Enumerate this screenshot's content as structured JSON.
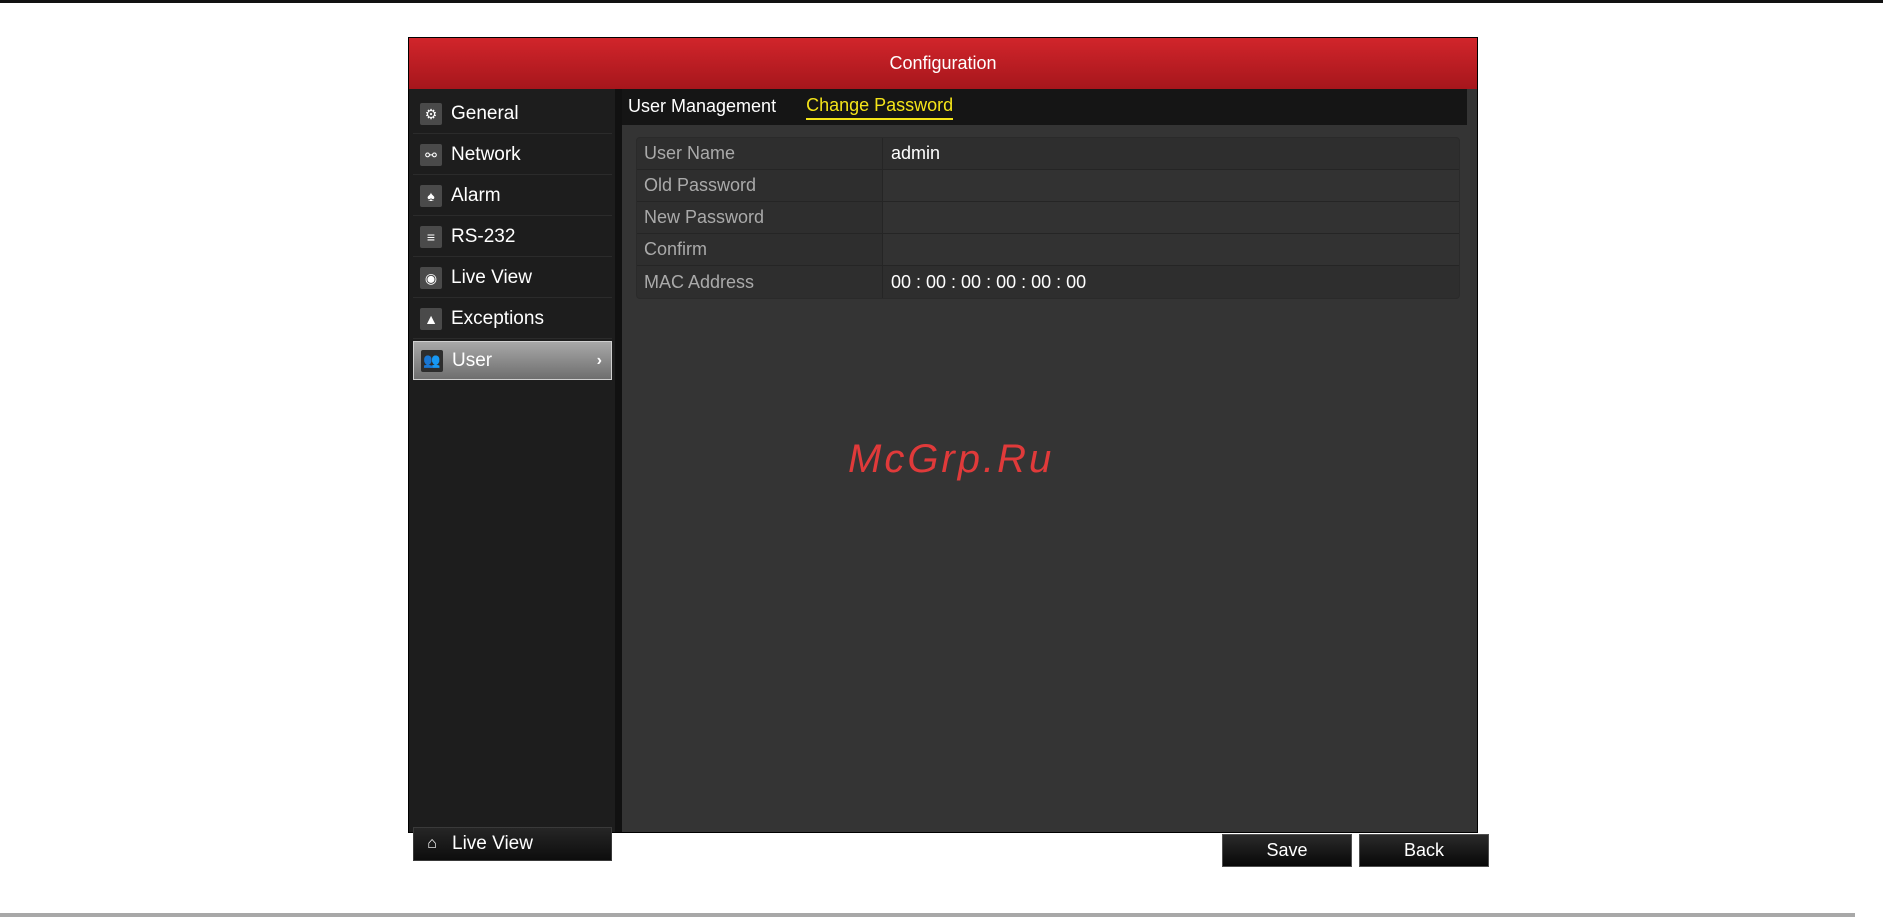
{
  "window": {
    "title": "Configuration"
  },
  "sidebar": {
    "items": [
      {
        "label": "General",
        "icon": "gear-icon",
        "glyph": "⚙"
      },
      {
        "label": "Network",
        "icon": "network-icon",
        "glyph": "⚯"
      },
      {
        "label": "Alarm",
        "icon": "alarm-bell-icon",
        "glyph": "♠"
      },
      {
        "label": "RS-232",
        "icon": "serial-port-icon",
        "glyph": "≡"
      },
      {
        "label": "Live View",
        "icon": "eye-icon",
        "glyph": "◉"
      },
      {
        "label": "Exceptions",
        "icon": "warning-icon",
        "glyph": "▲"
      },
      {
        "label": "User",
        "icon": "users-icon",
        "glyph": "👥",
        "active": true
      }
    ],
    "bottom": {
      "label": "Live View",
      "icon": "home-icon",
      "glyph": "⌂"
    }
  },
  "tabs": [
    {
      "label": "User Management",
      "active": false
    },
    {
      "label": "Change Password",
      "active": true
    }
  ],
  "form": {
    "rows": [
      {
        "label": "User Name",
        "value": "admin"
      },
      {
        "label": "Old Password",
        "value": ""
      },
      {
        "label": "New Password",
        "value": ""
      },
      {
        "label": "Confirm",
        "value": ""
      },
      {
        "label": "MAC Address",
        "value": "00 : 00 : 00 : 00 : 00 : 00"
      }
    ]
  },
  "buttons": {
    "save": "Save",
    "back": "Back"
  },
  "watermark": "McGrp.Ru",
  "colors": {
    "title_red": "#c41f25",
    "active_tab": "#f4e419",
    "watermark": "#e03a3a"
  }
}
